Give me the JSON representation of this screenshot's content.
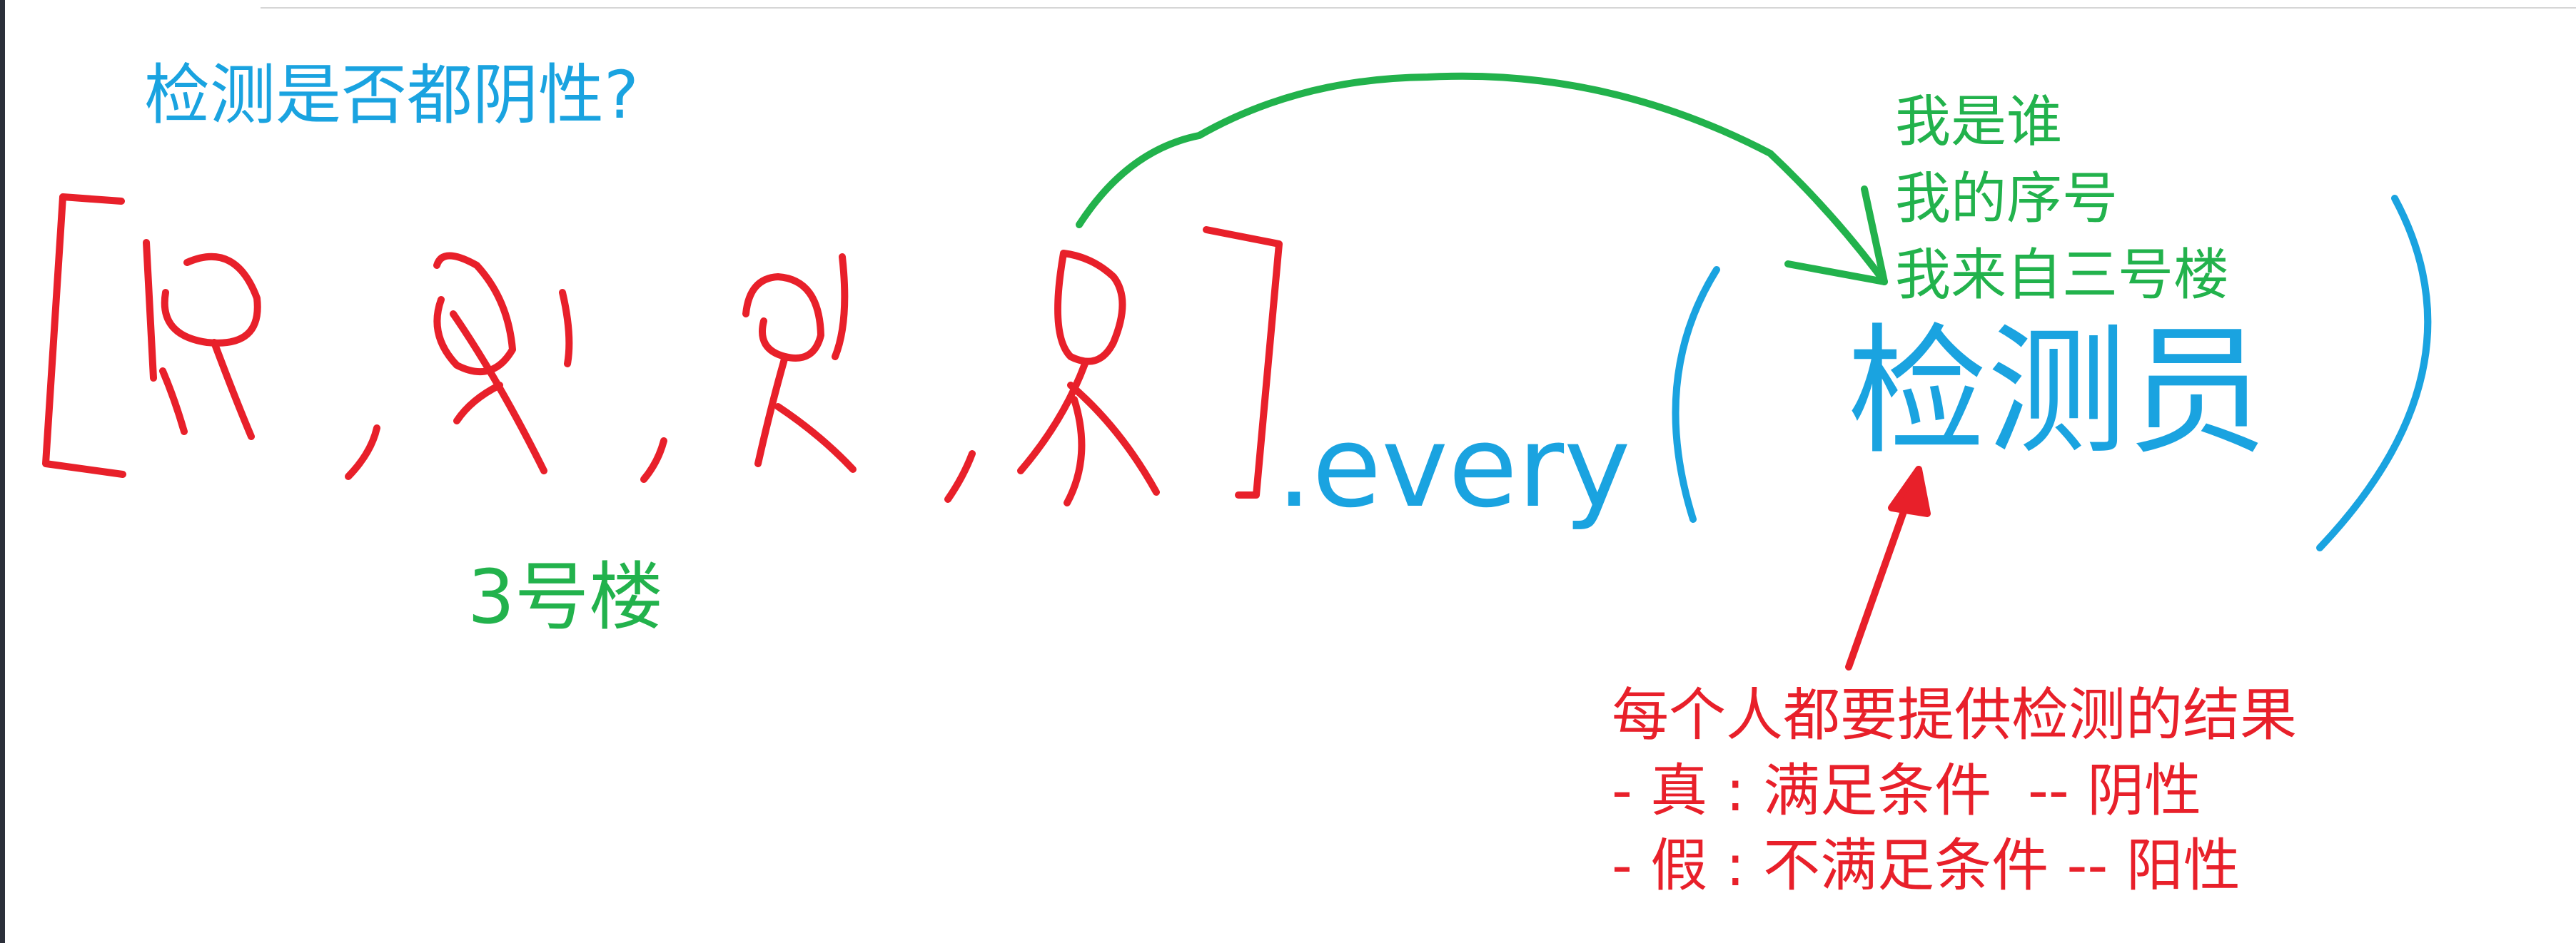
{
  "title": "检测是否都阴性?",
  "array_label": "3号楼",
  "method": ".every",
  "callback": "检测员",
  "params": [
    "我是谁",
    "我的序号",
    "我来自三号楼"
  ],
  "result": {
    "heading": "每个人都要提供检测的结果",
    "lines": [
      "- 真 : 满足条件  -- 阴性",
      "- 假 : 不满足条件 -- 阳性"
    ]
  },
  "colors": {
    "blue": "#1aa3e0",
    "green": "#22b24c",
    "red": "#e8202a"
  }
}
